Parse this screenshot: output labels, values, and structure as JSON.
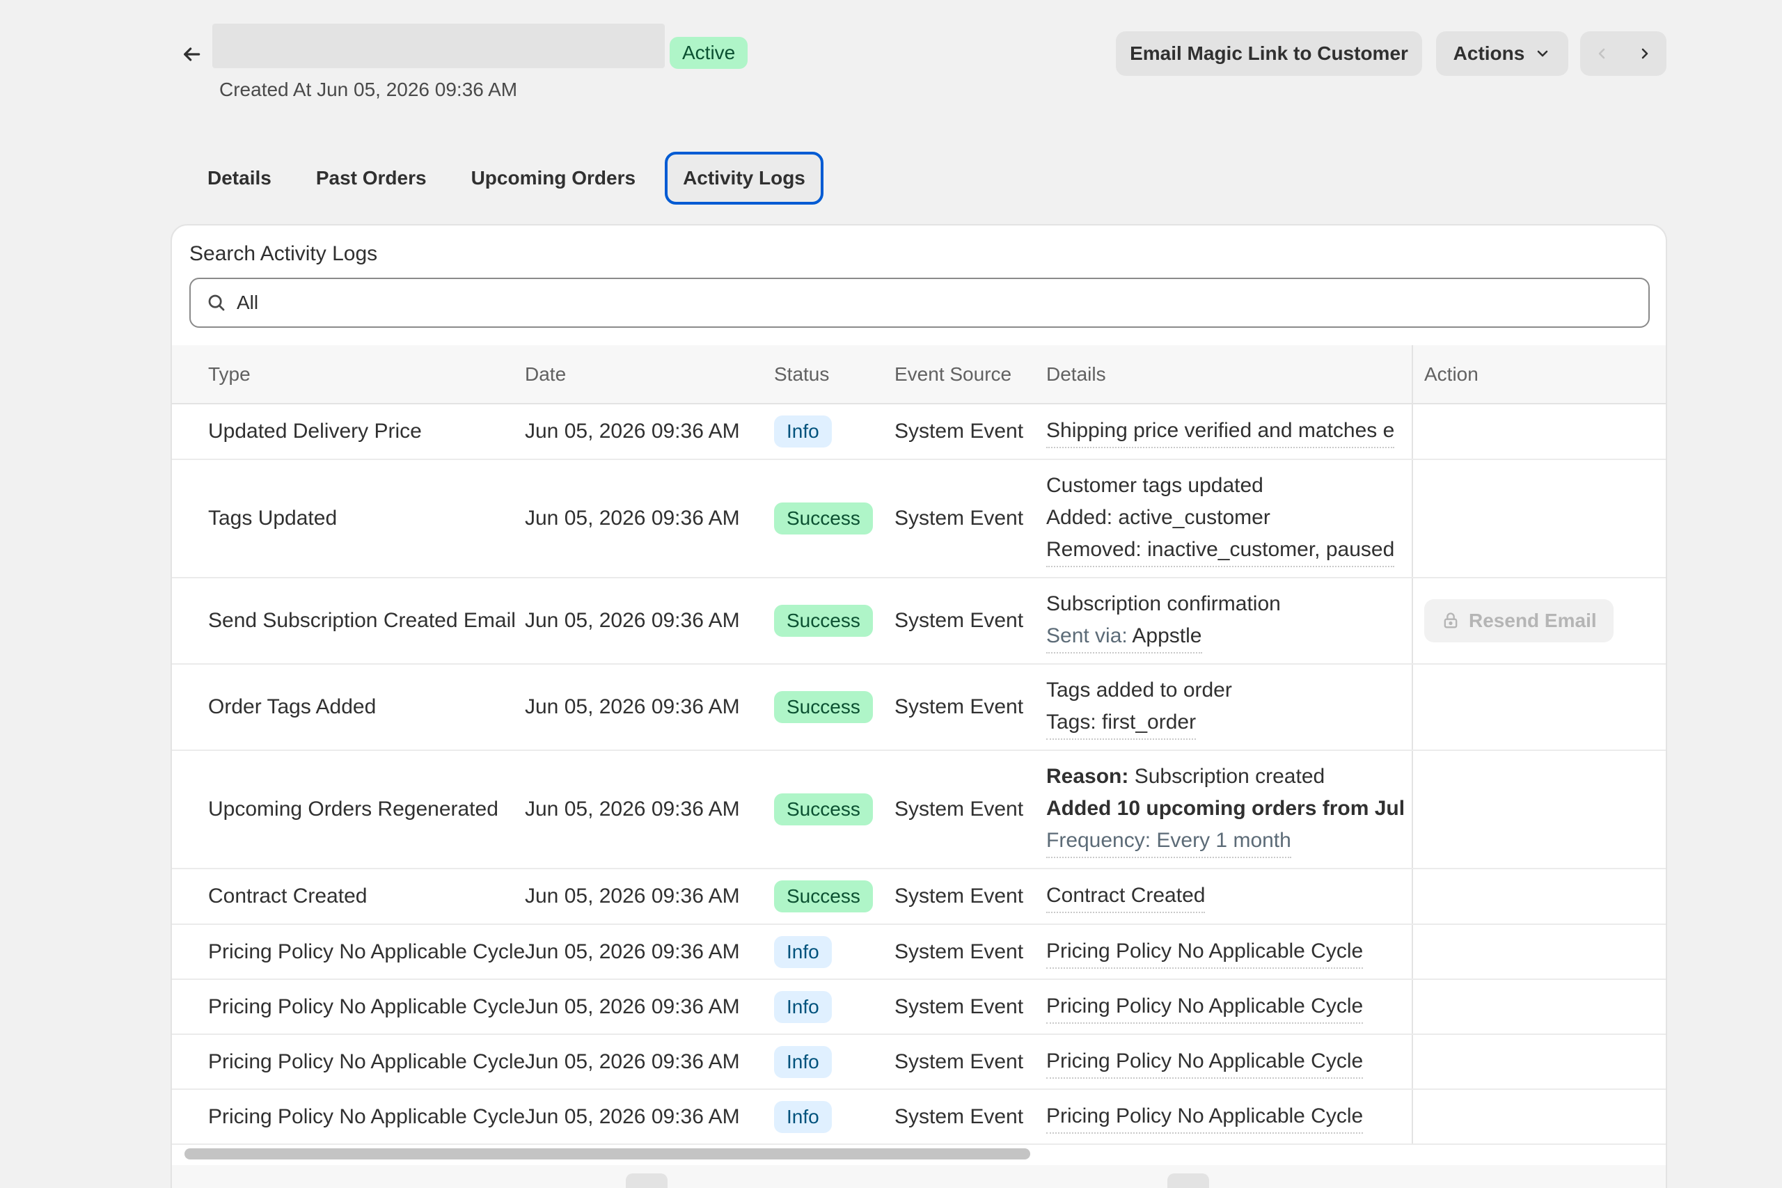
{
  "header": {
    "status": "Active",
    "created_at": "Created At Jun 05, 2026 09:36 AM",
    "email_button": "Email Magic Link to Customer",
    "actions_button": "Actions"
  },
  "tabs": [
    {
      "label": "Details"
    },
    {
      "label": "Past Orders"
    },
    {
      "label": "Upcoming Orders"
    },
    {
      "label": "Activity Logs",
      "active": true
    }
  ],
  "search": {
    "label": "Search Activity Logs",
    "value": "All"
  },
  "table": {
    "headers": [
      "Type",
      "Date",
      "Status",
      "Event Source",
      "Details",
      "Action"
    ],
    "rows": [
      {
        "type": "Updated Delivery Price",
        "date": "Jun 05, 2026 09:36 AM",
        "status": "Info",
        "source": "System Event",
        "details": [
          "Shipping price verified and matches e"
        ]
      },
      {
        "type": "Tags Updated",
        "date": "Jun 05, 2026 09:36 AM",
        "status": "Success",
        "source": "System Event",
        "details": [
          "Customer tags updated",
          "Added: active_customer",
          "Removed: inactive_customer, paused"
        ]
      },
      {
        "type": "Send Subscription Created Email",
        "date": "Jun 05, 2026 09:36 AM",
        "status": "Success",
        "source": "System Event",
        "details": [
          "Subscription confirmation"
        ],
        "sent_via_label": "Sent via:",
        "sent_via_value": "Appstle",
        "action": "Resend Email"
      },
      {
        "type": "Order Tags Added",
        "date": "Jun 05, 2026 09:36 AM",
        "status": "Success",
        "source": "System Event",
        "details": [
          "Tags added to order",
          "Tags: first_order"
        ]
      },
      {
        "type": "Upcoming Orders Regenerated",
        "date": "Jun 05, 2026 09:36 AM",
        "status": "Success",
        "source": "System Event",
        "reason_label": "Reason:",
        "reason_value": "Subscription created",
        "added_text": "Added 10 upcoming orders from Jul",
        "frequency": "Frequency: Every 1 month"
      },
      {
        "type": "Contract Created",
        "date": "Jun 05, 2026 09:36 AM",
        "status": "Success",
        "source": "System Event",
        "details": [
          "Contract Created"
        ]
      },
      {
        "type": "Pricing Policy No Applicable Cycle",
        "date": "Jun 05, 2026 09:36 AM",
        "status": "Info",
        "source": "System Event",
        "details": [
          "Pricing Policy No Applicable Cycle"
        ]
      },
      {
        "type": "Pricing Policy No Applicable Cycle",
        "date": "Jun 05, 2026 09:36 AM",
        "status": "Info",
        "source": "System Event",
        "details": [
          "Pricing Policy No Applicable Cycle"
        ]
      },
      {
        "type": "Pricing Policy No Applicable Cycle",
        "date": "Jun 05, 2026 09:36 AM",
        "status": "Info",
        "source": "System Event",
        "details": [
          "Pricing Policy No Applicable Cycle"
        ]
      },
      {
        "type": "Pricing Policy No Applicable Cycle",
        "date": "Jun 05, 2026 09:36 AM",
        "status": "Info",
        "source": "System Event",
        "details": [
          "Pricing Policy No Applicable Cycle"
        ]
      }
    ]
  },
  "colors": {
    "accent": "#005bd3",
    "success_bg": "#aff5c8",
    "info_bg": "#e0f0ff"
  },
  "icons": [
    "back-arrow-icon",
    "chevron-down-icon",
    "chevron-left-icon",
    "chevron-right-icon",
    "search-icon",
    "lock-icon"
  ]
}
